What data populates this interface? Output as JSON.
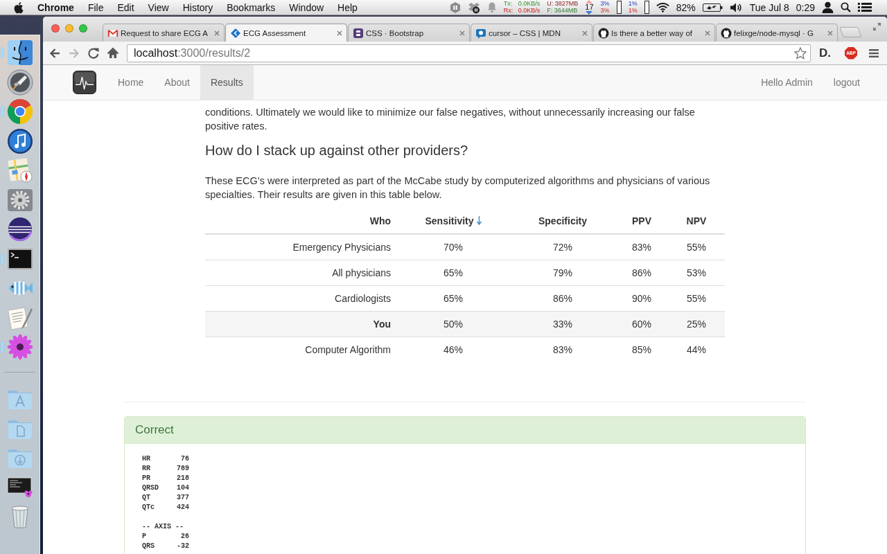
{
  "menubar": {
    "app": "Chrome",
    "menus": [
      "File",
      "Edit",
      "View",
      "History",
      "Bookmarks",
      "Window",
      "Help"
    ],
    "network": {
      "tx_label": "Tx:",
      "tx_value": "0.0KB/s",
      "rx_label": "Rx:",
      "rx_value": "0.0KB/s"
    },
    "memory": {
      "used": "U: 3827MB",
      "free": "F: 3644MB"
    },
    "counter": "17",
    "cpu": [
      {
        "user": "3%",
        "system": "3%"
      },
      {
        "user": "1%",
        "system": "1%"
      }
    ],
    "battery": "82%",
    "date": "Tue Jul 8",
    "time": "0:29"
  },
  "dock": {
    "apps": [
      {
        "running": true
      },
      {
        "running": false
      },
      {
        "running": true
      },
      {
        "running": false
      },
      {
        "running": false
      },
      {
        "running": false
      },
      {
        "running": false
      },
      {
        "running": true
      },
      {
        "running": false
      },
      {
        "running": false
      },
      {
        "running": true
      }
    ]
  },
  "browser": {
    "tabs": [
      {
        "title": "Request to share ECG A",
        "selected": false
      },
      {
        "title": "ECG Assessment",
        "selected": true
      },
      {
        "title": "CSS · Bootstrap",
        "selected": false
      },
      {
        "title": "cursor – CSS | MDN",
        "selected": false
      },
      {
        "title": "Is there a better way of",
        "selected": false
      },
      {
        "title": "felixge/node-mysql · G",
        "selected": false
      }
    ],
    "back_enabled": true,
    "forward_enabled": false,
    "address": {
      "host": "localhost",
      "path": ":3000/results/2"
    },
    "extensions": [
      "D.",
      "ABP"
    ]
  },
  "navbar": {
    "items": [
      {
        "label": "Home",
        "selected": false
      },
      {
        "label": "About",
        "selected": false
      },
      {
        "label": "Results",
        "selected": true
      }
    ],
    "right_items": [
      "Hello Admin",
      "logout"
    ]
  },
  "content": {
    "intro": "conditions. Ultimately we would like to minimize our false negatives, without unnecessarily increasing our false positive rates.",
    "heading": "How do I stack up against other providers?",
    "description": "These ECG’s were interpreted as part of the McCabe study by computerized algorithms and physicians of various specialties. Their results are given in this table below.",
    "table": {
      "columns": [
        {
          "label": "Who",
          "sorted": false
        },
        {
          "label": "Sensitivity",
          "sorted": true
        },
        {
          "label": "Specificity",
          "sorted": false
        },
        {
          "label": "PPV",
          "sorted": false
        },
        {
          "label": "NPV",
          "sorted": false
        }
      ],
      "rows": [
        {
          "cells": [
            "Emergency Physicians",
            "70%",
            "72%",
            "83%",
            "55%"
          ],
          "highlighted": false
        },
        {
          "cells": [
            "All physicians",
            "65%",
            "79%",
            "86%",
            "53%"
          ],
          "highlighted": false
        },
        {
          "cells": [
            "Cardiologists",
            "65%",
            "86%",
            "90%",
            "55%"
          ],
          "highlighted": false
        },
        {
          "cells": [
            "You",
            "50%",
            "33%",
            "60%",
            "25%"
          ],
          "highlighted": true
        },
        {
          "cells": [
            "Computer Algorithm",
            "46%",
            "83%",
            "85%",
            "44%"
          ],
          "highlighted": false
        }
      ]
    }
  },
  "panel": {
    "kind": "success",
    "title": "Correct",
    "measurements": [
      {
        "label": "HR",
        "value": "76"
      },
      {
        "label": "RR",
        "value": "789"
      },
      {
        "label": "PR",
        "value": "218"
      },
      {
        "label": "QRSD",
        "value": "104"
      },
      {
        "label": "QT",
        "value": "377"
      },
      {
        "label": "QTc",
        "value": "424"
      }
    ],
    "section": "-- AXIS --",
    "axis": [
      {
        "label": "P",
        "value": "26"
      },
      {
        "label": "QRS",
        "value": "-32"
      }
    ]
  }
}
